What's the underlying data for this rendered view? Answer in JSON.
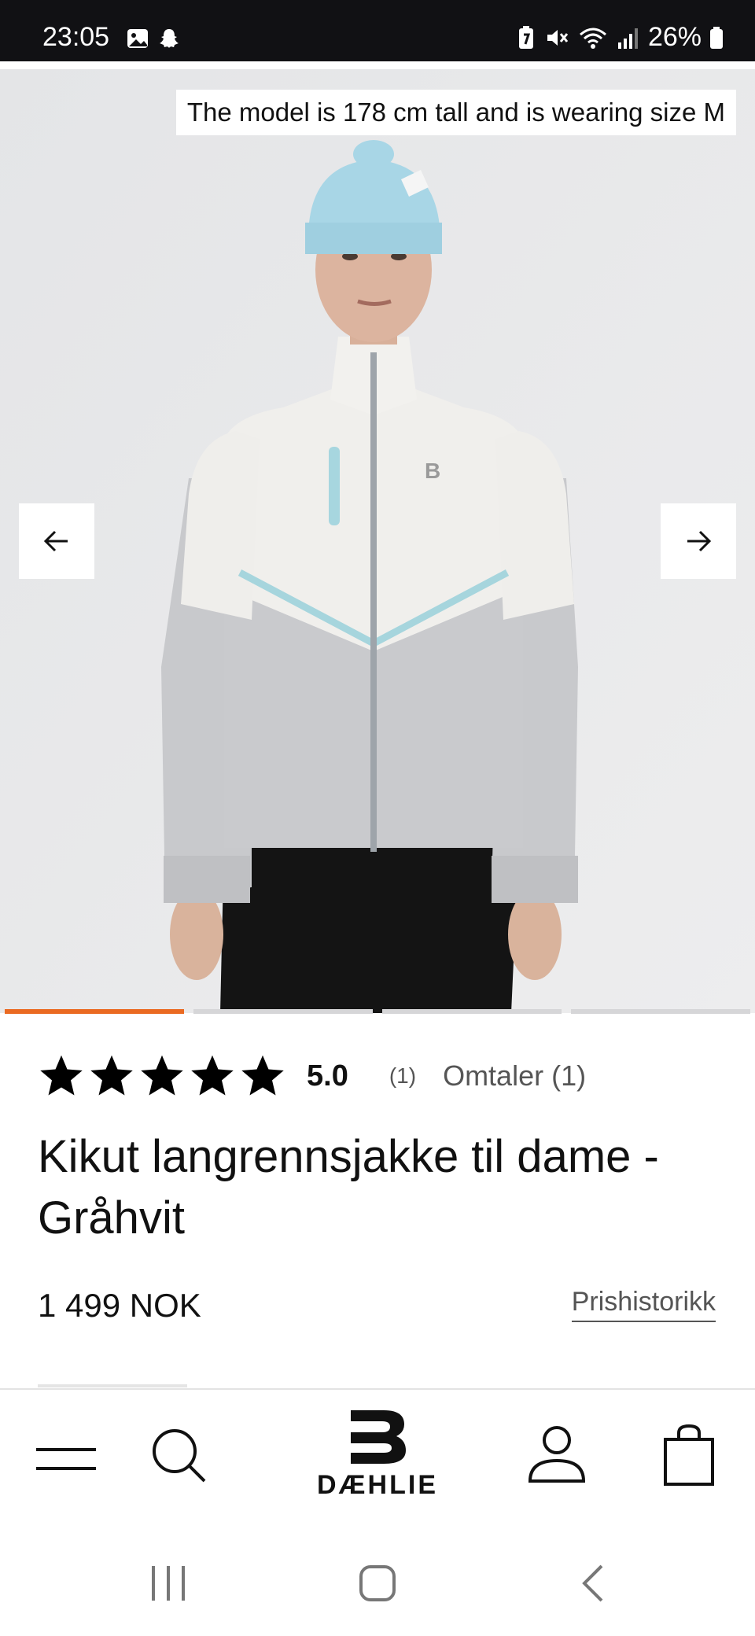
{
  "status_bar": {
    "time": "23:05",
    "battery": "26%",
    "icons": [
      "gallery-icon",
      "snapchat-icon",
      "battery-saver-icon",
      "mute-icon",
      "wifi-icon",
      "signal-icon",
      "battery-icon"
    ]
  },
  "hero": {
    "caption": "The model is 178 cm tall and is wearing size M",
    "prev_icon": "arrow-left-icon",
    "next_icon": "arrow-right-icon",
    "slides_total": 4,
    "active_slide": 1
  },
  "product": {
    "rating_value": "5.0",
    "rating_count": "(1)",
    "reviews_label": "Omtaler (1)",
    "stars": 5,
    "title": "Kikut langrennsjakke til dame - Gråhvit",
    "price": "1 499 NOK",
    "price_history_label": "Prishistorikk"
  },
  "bottom_nav": {
    "menu_icon": "hamburger-menu-icon",
    "search_icon": "search-icon",
    "logo_text": "DÆHLIE",
    "account_icon": "user-icon",
    "cart_icon": "shopping-bag-icon"
  },
  "system_nav": {
    "recents_icon": "recent-apps-icon",
    "home_icon": "home-icon",
    "back_icon": "back-icon"
  },
  "colors": {
    "accent": "#ea6a22",
    "jacket_light": "#f1f0ee",
    "jacket_grey": "#c9cacd",
    "hat": "#a8d6e6"
  }
}
